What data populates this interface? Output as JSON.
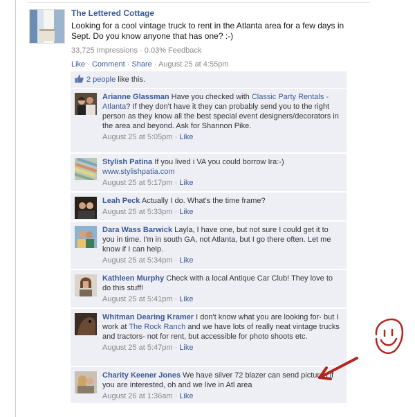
{
  "post": {
    "author": "The Lettered Cottage",
    "text": "Looking for a cool vintage truck to rent in the Atlanta area for a few days in Sept. Do you know anyone that has one? :-)",
    "impressions": "33,725 Impressions",
    "separator": " · ",
    "feedback": "0.03% Feedback",
    "actions": {
      "like": "Like",
      "comment": "Comment",
      "share": "Share",
      "timestamp": "August 25 at 4:55pm"
    }
  },
  "likes": {
    "count_link": "2 people",
    "suffix": " like this."
  },
  "comments": [
    {
      "author": "Arianne Glassman",
      "text_before": " Have you checked with ",
      "link": "Classic Party Rentals - Atlanta",
      "text_after": "? If they don't have it they can probably send you to the right person as they know all the best special event designers/decorators in the area and beyond. Ask for Shannon Pike.",
      "time": "August 25 at 5:05pm",
      "like": "Like"
    },
    {
      "author": "Stylish Patina",
      "text_before": " If you lived i VA you could borrow Ira:-) ",
      "link": "www.stylishpatia.com",
      "text_after": "",
      "time": "August 25 at 5:17pm",
      "like": "Like"
    },
    {
      "author": "Leah Peck",
      "text_before": " Actually I do. What's the time frame?",
      "link": "",
      "text_after": "",
      "time": "August 25 at 5:33pm",
      "like": "Like"
    },
    {
      "author": "Dara Wass Barwick",
      "text_before": " Layla, I have one, but not sure I could get it to you in time. I'm in south GA, not Atlanta, but I go there often. Let me know if I can help.",
      "link": "",
      "text_after": "",
      "time": "August 25 at 5:34pm",
      "like": "Like"
    },
    {
      "author": "Kathleen Murphy",
      "text_before": " Check with a local Antique Car Club! They love to do this stuff!",
      "link": "",
      "text_after": "",
      "time": "August 25 at 5:41pm",
      "like": "Like"
    },
    {
      "author": "Whitman Dearing Kramer",
      "text_before": " I don't know what you are looking for- but I work at ",
      "link": "The Rock Ranch",
      "text_after": " and we have lots of really neat vintage trucks and tractors- not for rent, but accessible for photo shoots etc.",
      "time": "August 25 at 5:47pm",
      "like": "Like"
    },
    {
      "author": "Charity Keener Jones",
      "text_before": " We have silver 72 blazer can send pictures if you are interested, oh and we live in Atl area",
      "link": "",
      "text_after": "",
      "time": "August 26 at 1:36am",
      "like": "Like"
    }
  ],
  "colors": {
    "link": "#3b5998",
    "comment_bg": "#edeff4",
    "meta": "#888888",
    "annotation_red": "#b3261e"
  },
  "icons": {
    "post_thumbnail": "cottage-photo",
    "likes": "thumbs-up-icon",
    "annotation_face": "smiley-face-drawing",
    "annotation_arrow": "red-arrow-drawing"
  }
}
